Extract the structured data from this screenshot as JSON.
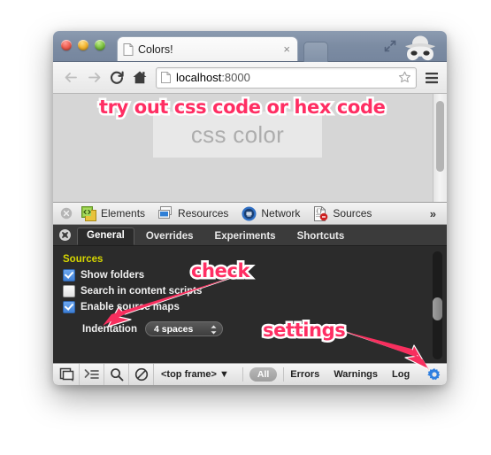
{
  "browser": {
    "tab": {
      "title": "Colors!",
      "close_label": "×",
      "favicon": "page-icon"
    },
    "window_controls": [
      "close",
      "minimize",
      "zoom"
    ],
    "expand_icon": "fullscreen-expand-icon",
    "profile_icon": "incognito-avatar-icon",
    "nav": {
      "back": "back-arrow-icon",
      "forward": "forward-arrow-icon",
      "reload": "reload-icon",
      "home": "home-icon",
      "url_host": "localhost",
      "url_port": ":8000",
      "url_full": "localhost:8000",
      "bookmark": "star-icon",
      "menu": "hamburger-menu-icon"
    }
  },
  "page": {
    "color_input_placeholder": "css color"
  },
  "devtools": {
    "close_label": "×",
    "panels": [
      {
        "label": "Elements",
        "icon": "elements-icon"
      },
      {
        "label": "Resources",
        "icon": "resources-icon"
      },
      {
        "label": "Network",
        "icon": "network-icon"
      },
      {
        "label": "Sources",
        "icon": "sources-icon"
      }
    ],
    "overflow_label": "»",
    "settings_tabs": [
      {
        "label": "General",
        "active": true
      },
      {
        "label": "Overrides",
        "active": false
      },
      {
        "label": "Experiments",
        "active": false
      },
      {
        "label": "Shortcuts",
        "active": false
      }
    ],
    "settings": {
      "section_heading": "Sources",
      "checkboxes": [
        {
          "label": "Show folders",
          "checked": true
        },
        {
          "label": "Search in content scripts",
          "checked": false
        },
        {
          "label": "Enable source maps",
          "checked": true
        }
      ],
      "indentation_label": "Indentation",
      "indentation_value": "4 spaces"
    },
    "statusbar": {
      "dock_icon": "dock-to-side-icon",
      "console_icon": "console-prompt-icon",
      "search_icon": "search-icon",
      "clear_icon": "clear-console-icon",
      "frame_selector": "<top frame>",
      "frame_caret": "▼",
      "all_label": "All",
      "filters": [
        "Errors",
        "Warnings",
        "Log"
      ],
      "gear_icon": "settings-gear-icon"
    }
  },
  "annotations": [
    {
      "text": "try out css code or hex code",
      "target": "css-color-input"
    },
    {
      "text": "check",
      "target": "source-maps-checkbox"
    },
    {
      "text": "settings",
      "target": "settings-gear-button"
    }
  ],
  "colors": {
    "annotation_pink": "#ff2e63",
    "annotation_outline": "#ffffff",
    "devtools_bg": "#2b2b2b",
    "sources_heading": "#d6d600",
    "gear_blue": "#2f7fe0"
  }
}
